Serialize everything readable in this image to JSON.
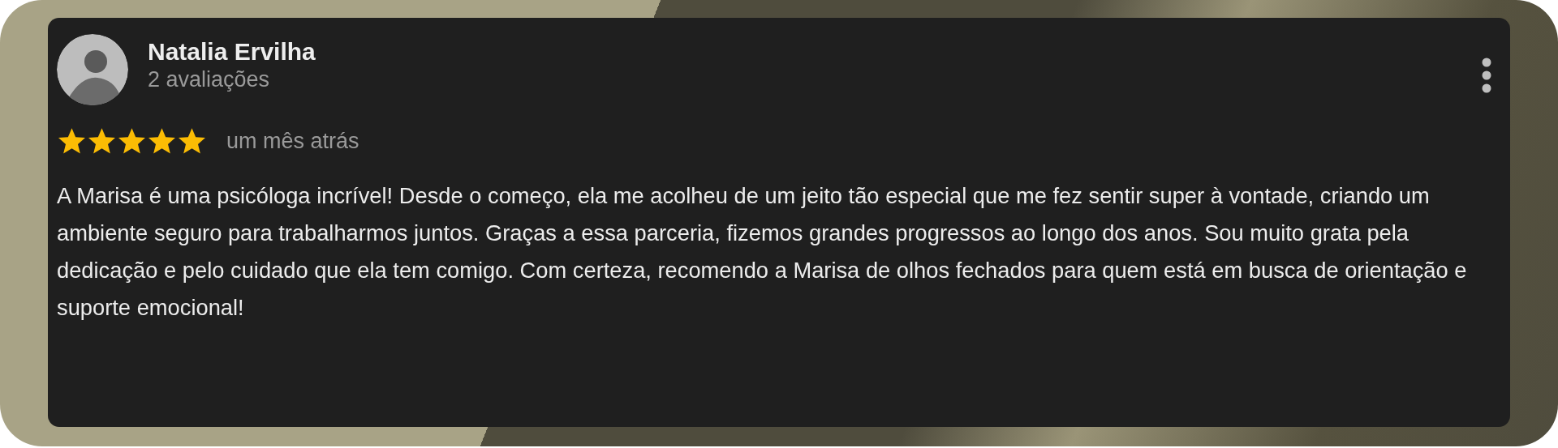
{
  "review": {
    "author": "Natalia Ervilha",
    "review_count": "2 avaliações",
    "stars": 5,
    "time": "um mês atrás",
    "text": "A Marisa é uma psicóloga incrível! Desde o começo, ela me acolheu de um jeito tão especial que me fez sentir super à vontade, criando um ambiente seguro para trabalharmos juntos. Graças a essa parceria, fizemos grandes progressos ao longo dos anos. Sou muito grata pela dedicação e pelo cuidado que ela tem comigo. Com certeza, recomendo a Marisa de olhos fechados para quem está em busca de orientação e suporte emocional!"
  }
}
